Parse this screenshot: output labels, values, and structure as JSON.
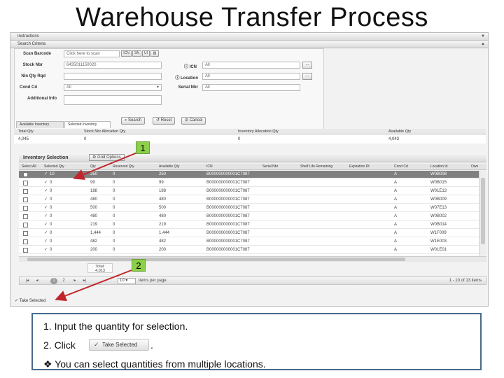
{
  "title": "Warehouse Transfer Process",
  "header_bars": {
    "instructions": "Instructions",
    "search_criteria": "Search Criteria"
  },
  "search": {
    "scan_barcode_label": "Scan Barcode",
    "scan_placeholder": "Click here to scan",
    "scan_tags": [
      "ICN",
      "SN",
      "UI"
    ],
    "stock_nbr_label": "Stock Nbr",
    "stock_nbr_value": "6435011150020",
    "icn_label": "ICN",
    "icn_value": "All",
    "nin_qty_rqd_label": "Nin Qty Rqd",
    "location_label": "Location",
    "location_value": "All",
    "cond_cd_label": "Cond Cd",
    "cond_cd_value": "All",
    "serial_nbr_label": "Serial Nbr",
    "serial_nbr_value": "All",
    "additional_info_label": "Additional Info",
    "search_btn": "Search",
    "reset_btn": "Reset",
    "cancel_btn": "Cancel"
  },
  "tabs": [
    "Available Inventory",
    "Selected Inventory"
  ],
  "summary": {
    "headers": [
      "Total Qty",
      "Stock Nbr Allocation Qty",
      "Inventory Allocation Qty",
      "Available Qty"
    ],
    "values": [
      "4,045",
      "0",
      "0",
      "4,043"
    ]
  },
  "inventory": {
    "title": "Inventory Selection",
    "grid_options": "Grid Options",
    "columns": [
      "Select All",
      "Selected Qty",
      "Qty",
      "Reserved Qty",
      "Available Qty",
      "ICN",
      "Serial Nbr",
      "Shelf Life Remaining",
      "Expiration Dt",
      "Cond Cd",
      "Location Id",
      "Own"
    ],
    "rows": [
      {
        "sel": "10",
        "qty": "250",
        "res": "0",
        "avail": "250",
        "icn": "B000000000001C7087",
        "cond": "A",
        "loc": "W0B008",
        "highlight": true
      },
      {
        "sel": "0",
        "qty": "99",
        "res": "0",
        "avail": "99",
        "icn": "B000000000001C7087",
        "cond": "A",
        "loc": "W0B015",
        "highlight": false
      },
      {
        "sel": "0",
        "qty": "188",
        "res": "0",
        "avail": "188",
        "icn": "B000000000001C7087",
        "cond": "A",
        "loc": "W01E13",
        "highlight": false
      },
      {
        "sel": "0",
        "qty": "480",
        "res": "0",
        "avail": "480",
        "icn": "B000000000001C7087",
        "cond": "A",
        "loc": "W0B009",
        "highlight": false
      },
      {
        "sel": "0",
        "qty": "500",
        "res": "0",
        "avail": "500",
        "icn": "B000000000001C7087",
        "cond": "A",
        "loc": "W07E13",
        "highlight": false
      },
      {
        "sel": "0",
        "qty": "480",
        "res": "0",
        "avail": "480",
        "icn": "B000000000001C7087",
        "cond": "A",
        "loc": "W0B002",
        "highlight": false
      },
      {
        "sel": "0",
        "qty": "219",
        "res": "0",
        "avail": "219",
        "icn": "B000000000001C7087",
        "cond": "A",
        "loc": "W0B014",
        "highlight": false
      },
      {
        "sel": "0",
        "qty": "1,444",
        "res": "0",
        "avail": "1,444",
        "icn": "B000000000001C7087",
        "cond": "A",
        "loc": "W1F009",
        "highlight": false
      },
      {
        "sel": "0",
        "qty": "482",
        "res": "0",
        "avail": "482",
        "icn": "B000000000001C7087",
        "cond": "A",
        "loc": "W1E003",
        "highlight": false
      },
      {
        "sel": "0",
        "qty": "200",
        "res": "0",
        "avail": "200",
        "icn": "B000000000001C7087",
        "cond": "A",
        "loc": "W01E01",
        "highlight": false
      }
    ],
    "total_label": "Total:",
    "total_value": "4,013"
  },
  "pager": {
    "pages": [
      "1",
      "2"
    ],
    "per_page_value": "10",
    "per_page_label": "items per page",
    "range_text": "1 - 10 of 13 items"
  },
  "take_selected_link": "Take Selected",
  "callouts": [
    "1",
    "2"
  ],
  "notes": {
    "line1": "1.  Input the quantity for selection.",
    "line2_prefix": "2.  Click",
    "line2_button": "Take Selected",
    "line2_suffix": ".",
    "line3_bullet": "❖",
    "line3": "You can select quantities from multiple locations."
  },
  "colors": {
    "callout_green": "#8cd04a",
    "arrow_red": "#c0262b",
    "note_border": "#4a6b8a",
    "selected_row": "#808080"
  }
}
